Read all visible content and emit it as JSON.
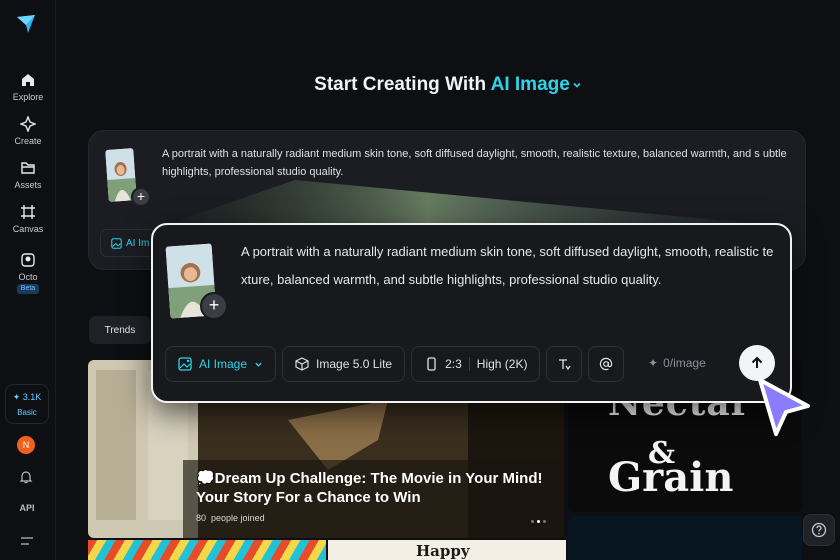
{
  "sidebar": {
    "items": [
      {
        "label": "Explore",
        "icon": "home-icon"
      },
      {
        "label": "Create",
        "icon": "sparkle-icon"
      },
      {
        "label": "Assets",
        "icon": "folder-icon"
      },
      {
        "label": "Canvas",
        "icon": "canvas-icon"
      },
      {
        "label": "Octo",
        "icon": "octo-icon",
        "badge": "Beta"
      }
    ],
    "credits": {
      "amount": "3.1K",
      "plan": "Basic"
    },
    "avatar_initial": "N",
    "api_label": "API"
  },
  "heading": {
    "prefix": "Start Creating With",
    "accent": "AI Image"
  },
  "prompt": {
    "text": "A portrait with a naturally radiant medium skin tone, soft diffused daylight, smooth, realistic texture, balanced warmth, and subtle highlights, professional studio quality.",
    "bg_text": "A portrait with a naturally radiant medium skin tone, soft diffused daylight, smooth, realistic texture, balanced warmth, and s ubtle highlights, professional studio quality.",
    "bg_mode_chip": "AI Im",
    "mode": "AI Image",
    "model": "Image 5.0 Lite",
    "ratio": "2:3",
    "quality": "High (2K)",
    "cost": "0/image"
  },
  "feed": {
    "tab": "Trends",
    "banner_title": "💭Dream Up Challenge: The Movie in Your Mind! Your Story For a Chance to Win",
    "banner_count": "80",
    "banner_joined": "people joined",
    "poster_word1": "Nectar",
    "poster_amp": "&",
    "poster_word2": "Grain",
    "tile_text": "Happy"
  },
  "colors": {
    "accent": "#2fd4e9",
    "cursor": "#8b7bff",
    "avatar": "#f0611f"
  }
}
